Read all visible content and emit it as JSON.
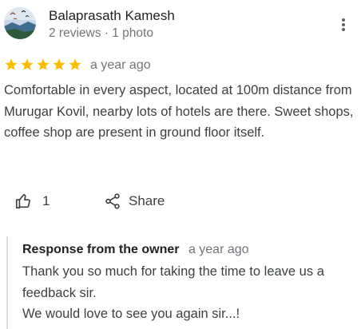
{
  "reviewer": {
    "name": "Balaprasath Kamesh",
    "meta": "2 reviews · 1 photo"
  },
  "review": {
    "rating": 5,
    "max_rating": 5,
    "date": "a year ago",
    "text": "Comfortable in every aspect, located at 100m distance from Murugar Kovil, nearby lots of hotels are there. Sweet shops, coffee shop are present in ground floor itself."
  },
  "actions": {
    "like_count": "1",
    "share_label": "Share"
  },
  "owner_response": {
    "title": "Response from the owner",
    "date": "a year ago",
    "lines": [
      "Thank you so much for taking the time to leave us a feedback sir.",
      "We would love to see you again sir...!"
    ]
  },
  "colors": {
    "star": "#fbbc04",
    "secondary_text": "#70757a",
    "body_text": "#3c4043",
    "divider": "#dadce0"
  },
  "icons": {
    "more": "more-vert-icon",
    "like": "thumb-up-icon",
    "share": "share-icon"
  }
}
